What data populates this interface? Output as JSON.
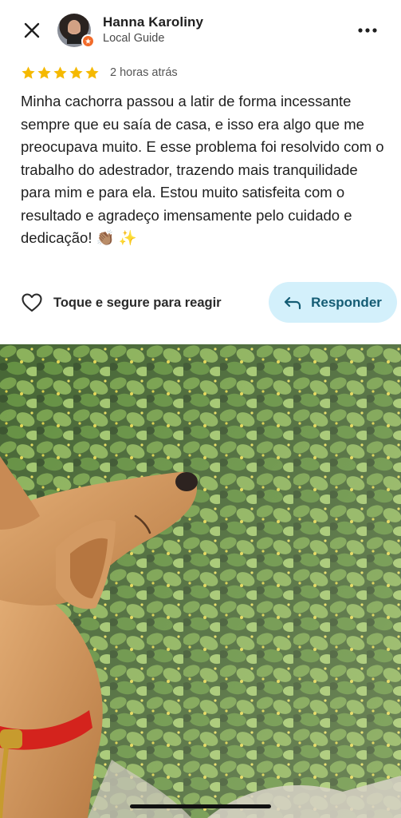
{
  "header": {
    "user_name": "Hanna Karoliny",
    "user_role": "Local Guide",
    "close_icon": "close-icon",
    "more_icon": "more-options-icon"
  },
  "review": {
    "rating": 5,
    "max_rating": 5,
    "time_ago": "2 horas atrás",
    "text": "Minha cachorra passou a latir de forma incessante sempre que eu saía de casa, e isso era algo que me preocupava muito. E esse problema foi resolvido com o trabalho do adestrador, trazendo mais tranquilidade para mim e para ela. Estou muito satisfeita com o resultado e agradeço imensamente pelo cuidado e dedicação! 👏🏽 ✨"
  },
  "actions": {
    "react_label": "Toque e segure para reagir",
    "reply_label": "Responder"
  },
  "colors": {
    "star": "#f5b900",
    "reply_bg": "#d3f0fb",
    "reply_text": "#145c74",
    "local_guide_badge": "#f26b2a"
  }
}
